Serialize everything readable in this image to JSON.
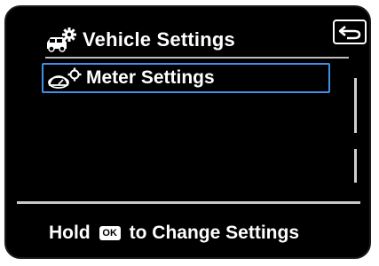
{
  "header": {
    "icon": "car-gear-icon",
    "title": "Vehicle Settings",
    "back_icon": "back-arrow-icon"
  },
  "menu": {
    "items": [
      {
        "icon": "meter-gear-icon",
        "label": "Meter Settings",
        "selected": true
      }
    ]
  },
  "footer": {
    "prefix": "Hold",
    "key_label": "OK",
    "suffix": "to Change Settings"
  },
  "colors": {
    "background": "#000000",
    "text": "#ffffff",
    "selection_border": "#3f8fe6",
    "divider": "#c8c8c8"
  }
}
